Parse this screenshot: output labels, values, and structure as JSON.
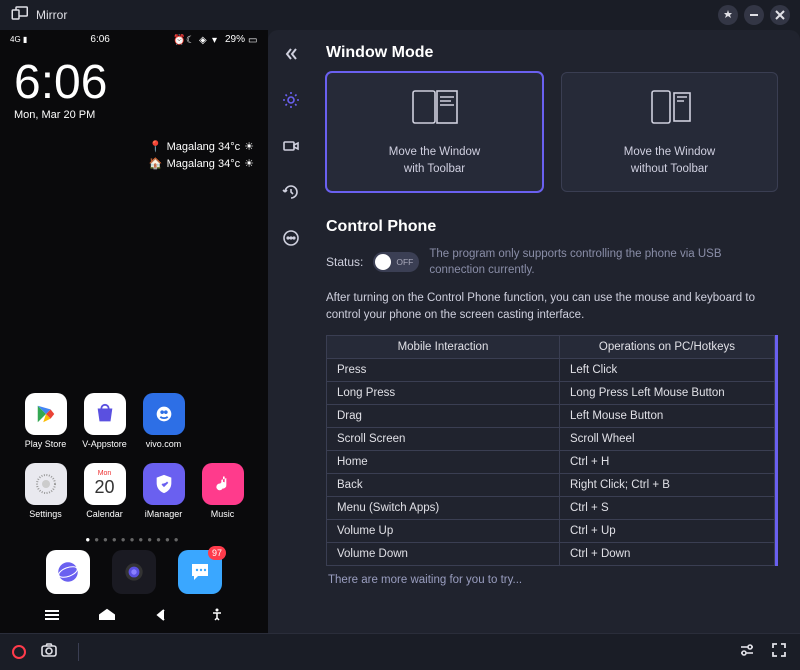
{
  "app": {
    "title": "Mirror"
  },
  "phone": {
    "status_time": "6:06",
    "status_battery": "29%",
    "big_time": "6:06",
    "date_line": "Mon, Mar 20 PM",
    "weather": [
      {
        "pin": "pin-icon",
        "text": "Magalang 34°c"
      },
      {
        "pin": "home-icon",
        "text": "Magalang 34°c"
      }
    ],
    "apps_row1": [
      {
        "label": "Play Store",
        "bg": "#ffffff"
      },
      {
        "label": "V-Appstore",
        "bg": "#ffffff"
      },
      {
        "label": "vivo.com",
        "bg": "#2d6fe6"
      }
    ],
    "apps_row2": [
      {
        "label": "Settings",
        "bg": "#e9e9ef"
      },
      {
        "label": "Calendar",
        "bg": "#ffffff",
        "num": "20",
        "mon": "Mon"
      },
      {
        "label": "iManager",
        "bg": "#6a60f0"
      },
      {
        "label": "Music",
        "bg": "#ff3b8c"
      }
    ],
    "dock": [
      {
        "name": "browser",
        "bg": "#ffffff"
      },
      {
        "name": "camera",
        "bg": "#1a1a22"
      },
      {
        "name": "messages",
        "bg": "#3aa7ff",
        "badge": "97"
      }
    ]
  },
  "content": {
    "window_mode_title": "Window Mode",
    "mode_cards": [
      {
        "line1": "Move the Window",
        "line2": "with Toolbar"
      },
      {
        "line1": "Move the Window",
        "line2": "without Toolbar"
      }
    ],
    "control_title": "Control Phone",
    "status_label": "Status:",
    "toggle_state": "OFF",
    "status_note": "The program only supports controlling the phone via USB connection currently.",
    "desc": "After turning on the Control Phone function, you can use the mouse and keyboard to control your phone on the screen casting interface.",
    "table": {
      "headers": [
        "Mobile Interaction",
        "Operations on PC/Hotkeys"
      ],
      "rows": [
        [
          "Press",
          "Left Click"
        ],
        [
          "Long Press",
          "Long Press Left Mouse Button"
        ],
        [
          "Drag",
          "Left Mouse Button"
        ],
        [
          "Scroll Screen",
          "Scroll Wheel"
        ],
        [
          "Home",
          "Ctrl + H"
        ],
        [
          "Back",
          "Right Click; Ctrl + B"
        ],
        [
          "Menu (Switch Apps)",
          "Ctrl + S"
        ],
        [
          "Volume Up",
          "Ctrl + Up"
        ],
        [
          "Volume Down",
          "Ctrl + Down"
        ]
      ]
    },
    "try_note": "There are more waiting for you to try..."
  }
}
